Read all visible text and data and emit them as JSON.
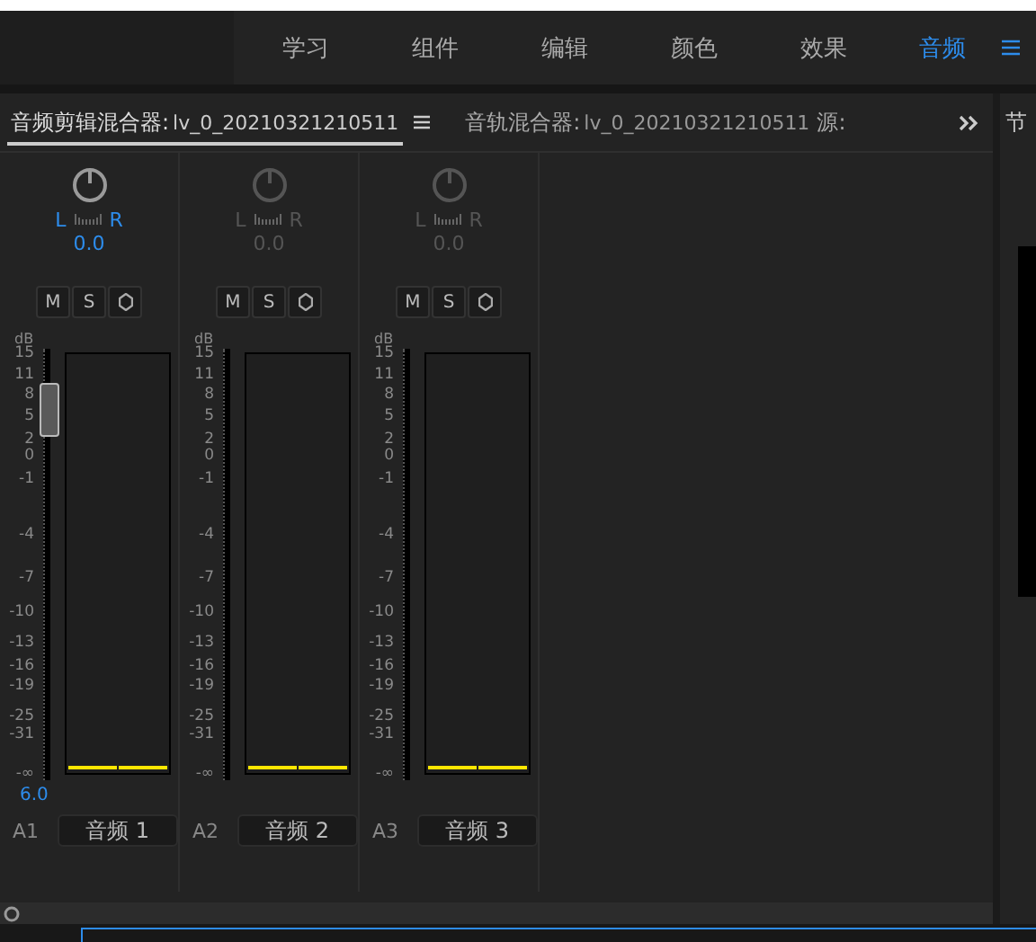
{
  "workspace_tabs": [
    {
      "label": "学习",
      "selected": false
    },
    {
      "label": "组件",
      "selected": false
    },
    {
      "label": "编辑",
      "selected": false
    },
    {
      "label": "颜色",
      "selected": false
    },
    {
      "label": "效果",
      "selected": false
    },
    {
      "label": "音频",
      "selected": true
    }
  ],
  "panel_tabs": [
    {
      "label": "音频剪辑混合器:",
      "sequence": "lv_0_20210321210511",
      "selected": true
    },
    {
      "label": "音轨混合器:",
      "sequence": "lv_0_20210321210511",
      "selected": false
    },
    {
      "label": "源:",
      "selected": false
    }
  ],
  "side_panel": {
    "title": "节"
  },
  "channels": [
    {
      "pan_left": "L",
      "pan_right": "R",
      "pan_value": "0.0",
      "enabled": true,
      "buttons": [
        "M",
        "S"
      ],
      "unit": "dB",
      "ticks": [
        "15",
        "11",
        "8",
        "5",
        "2",
        "0",
        "-1",
        "-4",
        "-7",
        "-10",
        "-13",
        "-16",
        "-19",
        "-25",
        "-31",
        "-∞"
      ],
      "level": 0.86,
      "fader_value": "6.0",
      "track": "A1",
      "name": "音频 1"
    },
    {
      "pan_left": "L",
      "pan_right": "R",
      "pan_value": "0.0",
      "enabled": false,
      "buttons": [
        "M",
        "S"
      ],
      "unit": "dB",
      "ticks": [
        "15",
        "11",
        "8",
        "5",
        "2",
        "0",
        "-1",
        "-4",
        "-7",
        "-10",
        "-13",
        "-16",
        "-19",
        "-25",
        "-31",
        "-∞"
      ],
      "track": "A2",
      "name": "音频 2"
    },
    {
      "pan_left": "L",
      "pan_right": "R",
      "pan_value": "0.0",
      "enabled": false,
      "buttons": [
        "M",
        "S"
      ],
      "unit": "dB",
      "ticks": [
        "15",
        "11",
        "8",
        "5",
        "2",
        "0",
        "-1",
        "-4",
        "-7",
        "-10",
        "-13",
        "-16",
        "-19",
        "-25",
        "-31",
        "-∞"
      ],
      "track": "A3",
      "name": "音频 3"
    }
  ]
}
